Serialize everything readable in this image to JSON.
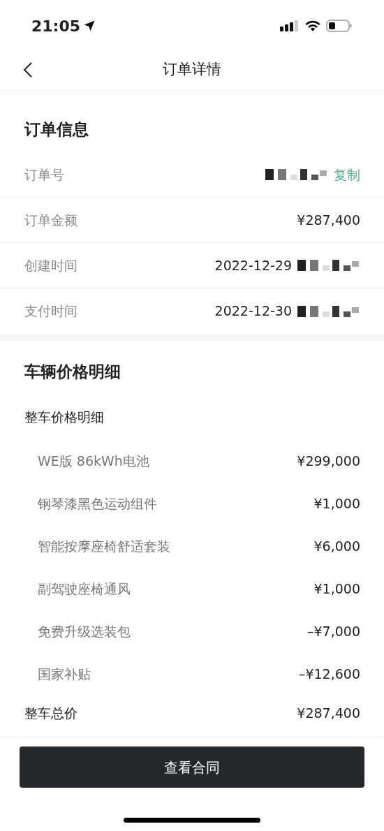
{
  "status_bar": {
    "time": "21:05"
  },
  "nav": {
    "title": "订单详情"
  },
  "order_info": {
    "title": "订单信息",
    "rows": [
      {
        "label": "订单号",
        "value": "",
        "redacted": true,
        "action": "复制"
      },
      {
        "label": "订单金额",
        "value": "¥287,400",
        "redacted": false
      },
      {
        "label": "创建时间",
        "value": "2022-12-29",
        "redacted": true
      },
      {
        "label": "支付时间",
        "value": "2022-12-30",
        "redacted": true
      }
    ]
  },
  "price_details": {
    "title": "车辆价格明细",
    "subtitle": "整车价格明细",
    "items": [
      {
        "name": "WE版 86kWh电池",
        "price": "¥299,000"
      },
      {
        "name": "钢琴漆黑色运动组件",
        "price": "¥1,000"
      },
      {
        "name": "智能按摩座椅舒适套装",
        "price": "¥6,000"
      },
      {
        "name": "副驾驶座椅通风",
        "price": "¥1,000"
      },
      {
        "name": "免费升级选装包",
        "price": "–¥7,000"
      },
      {
        "name": "国家补贴",
        "price": "–¥12,600"
      }
    ],
    "total": {
      "label": "整车总价",
      "value": "¥287,400"
    }
  },
  "button": "查看合同"
}
